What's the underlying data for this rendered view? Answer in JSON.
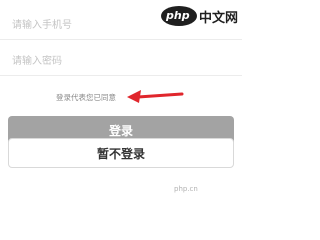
{
  "form": {
    "phone_placeholder": "请输入手机号",
    "password_placeholder": "请输入密码",
    "agreement_text": "登录代表您已同意"
  },
  "buttons": {
    "login_label": "登录",
    "skip_label": "暂不登录"
  },
  "watermark": {
    "logo_text": "php",
    "site_text": "中文网",
    "footer_text": "php.cn"
  },
  "colors": {
    "login_button": "#a3a3a3",
    "arrow": "#e0262c"
  }
}
